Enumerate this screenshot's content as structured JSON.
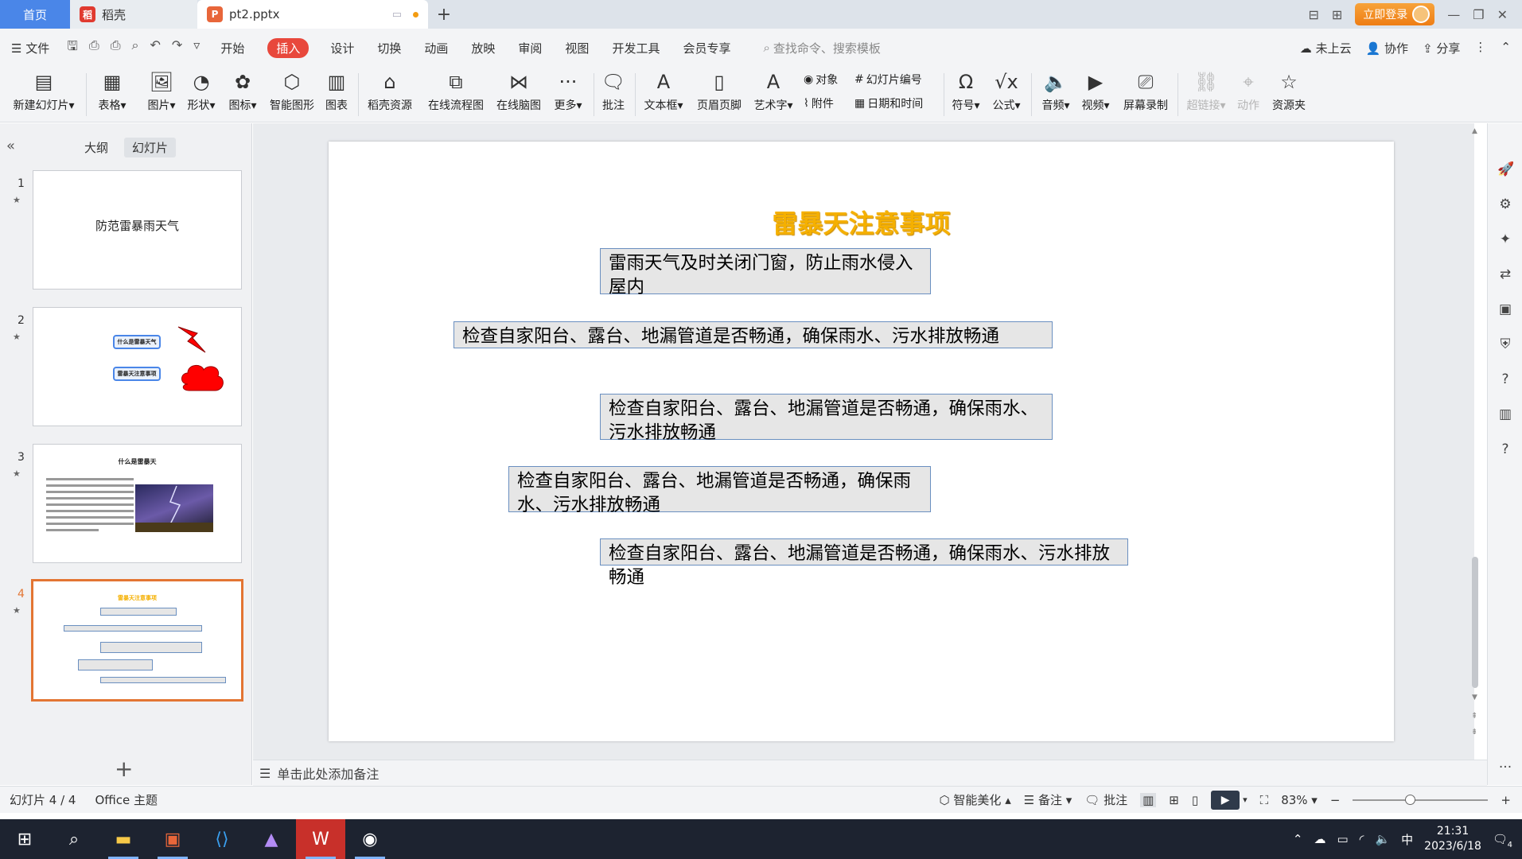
{
  "titlebar": {
    "home_tab": "首页",
    "daoke_tab": "稻壳",
    "active_tab": "pt2.pptx",
    "login": "立即登录"
  },
  "menu": {
    "file": "文件",
    "items": [
      "开始",
      "插入",
      "设计",
      "切换",
      "动画",
      "放映",
      "审阅",
      "视图",
      "开发工具",
      "会员专享"
    ],
    "search_placeholder": "查找命令、搜索模板",
    "cloud": "未上云",
    "collab": "协作",
    "share": "分享"
  },
  "ribbon": {
    "new_slide": "新建幻灯片",
    "table": "表格",
    "picture": "图片",
    "shape": "形状",
    "icon": "图标",
    "smart_shape": "智能图形",
    "chart": "图表",
    "daoke_res": "稻壳资源",
    "online_flow": "在线流程图",
    "online_mind": "在线脑图",
    "more": "更多",
    "comment": "批注",
    "textbox": "文本框",
    "header_footer": "页眉页脚",
    "wordart": "艺术字",
    "object": "对象",
    "attachment": "附件",
    "slide_number": "幻灯片编号",
    "datetime": "日期和时间",
    "symbol": "符号",
    "formula": "公式",
    "audio": "音频",
    "video": "视频",
    "screen_record": "屏幕录制",
    "hyperlink": "超链接",
    "action": "动作",
    "resource": "资源夹"
  },
  "panel": {
    "outline_tab": "大纲",
    "slides_tab": "幻灯片",
    "thumbs": [
      {
        "num": "1",
        "title": "防范雷暴雨天气"
      },
      {
        "num": "2",
        "box1": "什么是雷暴天气",
        "box2": "雷暴天注意事项"
      },
      {
        "num": "3",
        "title": "什么是雷暴天"
      },
      {
        "num": "4",
        "title": "雷暴天注意事项"
      }
    ]
  },
  "slide": {
    "title": "雷暴天注意事项",
    "boxes": [
      "雷雨天气及时关闭门窗，防止雨水侵入屋内",
      "检查自家阳台、露台、地漏管道是否畅通，确保雨水、污水排放畅通",
      "检查自家阳台、露台、地漏管道是否畅通，确保雨水、污水排放畅通",
      "检查自家阳台、露台、地漏管道是否畅通，确保雨水、污水排放畅通",
      "检查自家阳台、露台、地漏管道是否畅通，确保雨水、污水排放畅通"
    ]
  },
  "notes": {
    "placeholder": "单击此处添加备注"
  },
  "status": {
    "slide_info": "幻灯片 4 / 4",
    "theme": "Office 主题",
    "beautify": "智能美化",
    "notes": "备注",
    "comments": "批注",
    "zoom": "83%"
  },
  "taskbar": {
    "ime": "中",
    "time": "21:31",
    "date": "2023/6/18",
    "notif_count": "4"
  },
  "colors": {
    "accent_red": "#e8483c",
    "title_gold": "#f5b000",
    "thumb_selected": "#e37533"
  }
}
